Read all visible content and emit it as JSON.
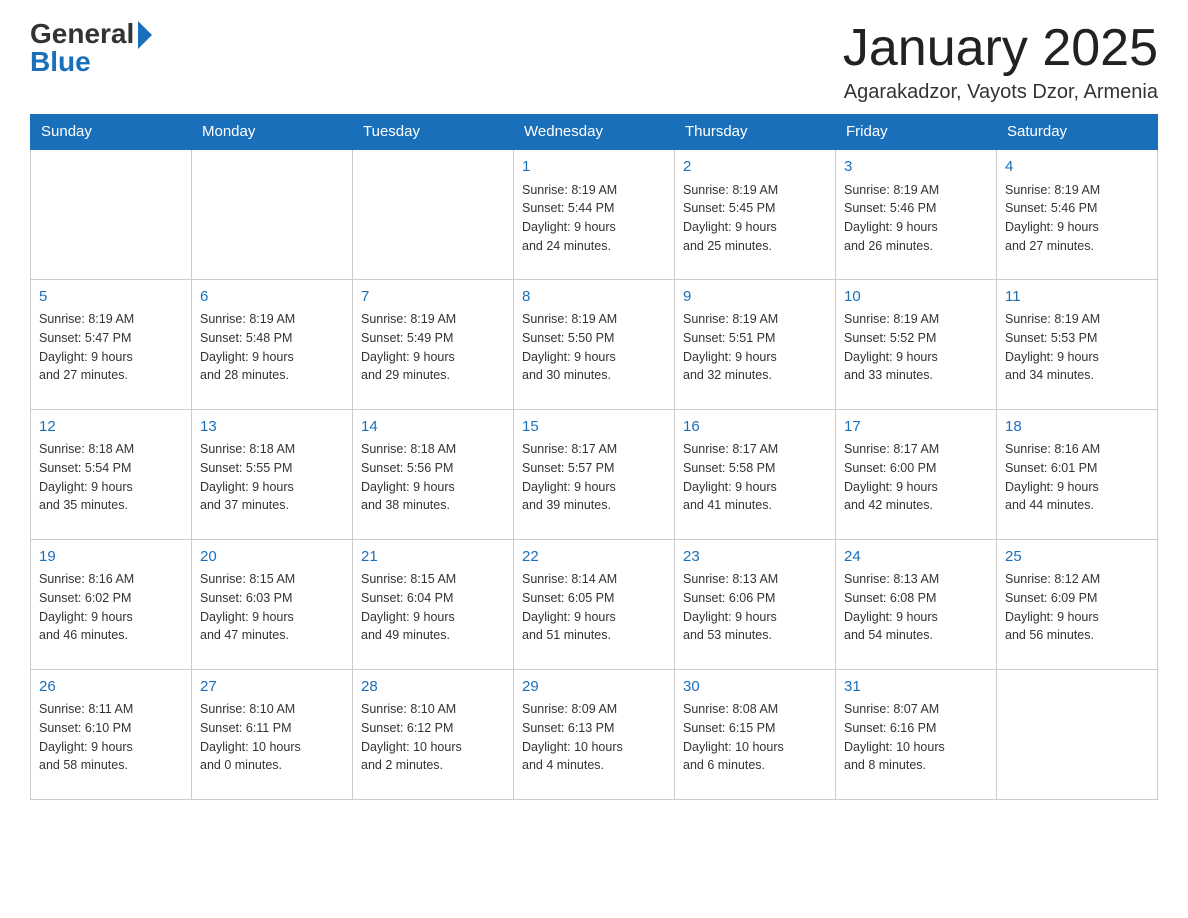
{
  "header": {
    "logo_general": "General",
    "logo_blue": "Blue",
    "title": "January 2025",
    "location": "Agarakadzor, Vayots Dzor, Armenia"
  },
  "days_of_week": [
    "Sunday",
    "Monday",
    "Tuesday",
    "Wednesday",
    "Thursday",
    "Friday",
    "Saturday"
  ],
  "weeks": [
    [
      {
        "day": "",
        "info": ""
      },
      {
        "day": "",
        "info": ""
      },
      {
        "day": "",
        "info": ""
      },
      {
        "day": "1",
        "info": "Sunrise: 8:19 AM\nSunset: 5:44 PM\nDaylight: 9 hours\nand 24 minutes."
      },
      {
        "day": "2",
        "info": "Sunrise: 8:19 AM\nSunset: 5:45 PM\nDaylight: 9 hours\nand 25 minutes."
      },
      {
        "day": "3",
        "info": "Sunrise: 8:19 AM\nSunset: 5:46 PM\nDaylight: 9 hours\nand 26 minutes."
      },
      {
        "day": "4",
        "info": "Sunrise: 8:19 AM\nSunset: 5:46 PM\nDaylight: 9 hours\nand 27 minutes."
      }
    ],
    [
      {
        "day": "5",
        "info": "Sunrise: 8:19 AM\nSunset: 5:47 PM\nDaylight: 9 hours\nand 27 minutes."
      },
      {
        "day": "6",
        "info": "Sunrise: 8:19 AM\nSunset: 5:48 PM\nDaylight: 9 hours\nand 28 minutes."
      },
      {
        "day": "7",
        "info": "Sunrise: 8:19 AM\nSunset: 5:49 PM\nDaylight: 9 hours\nand 29 minutes."
      },
      {
        "day": "8",
        "info": "Sunrise: 8:19 AM\nSunset: 5:50 PM\nDaylight: 9 hours\nand 30 minutes."
      },
      {
        "day": "9",
        "info": "Sunrise: 8:19 AM\nSunset: 5:51 PM\nDaylight: 9 hours\nand 32 minutes."
      },
      {
        "day": "10",
        "info": "Sunrise: 8:19 AM\nSunset: 5:52 PM\nDaylight: 9 hours\nand 33 minutes."
      },
      {
        "day": "11",
        "info": "Sunrise: 8:19 AM\nSunset: 5:53 PM\nDaylight: 9 hours\nand 34 minutes."
      }
    ],
    [
      {
        "day": "12",
        "info": "Sunrise: 8:18 AM\nSunset: 5:54 PM\nDaylight: 9 hours\nand 35 minutes."
      },
      {
        "day": "13",
        "info": "Sunrise: 8:18 AM\nSunset: 5:55 PM\nDaylight: 9 hours\nand 37 minutes."
      },
      {
        "day": "14",
        "info": "Sunrise: 8:18 AM\nSunset: 5:56 PM\nDaylight: 9 hours\nand 38 minutes."
      },
      {
        "day": "15",
        "info": "Sunrise: 8:17 AM\nSunset: 5:57 PM\nDaylight: 9 hours\nand 39 minutes."
      },
      {
        "day": "16",
        "info": "Sunrise: 8:17 AM\nSunset: 5:58 PM\nDaylight: 9 hours\nand 41 minutes."
      },
      {
        "day": "17",
        "info": "Sunrise: 8:17 AM\nSunset: 6:00 PM\nDaylight: 9 hours\nand 42 minutes."
      },
      {
        "day": "18",
        "info": "Sunrise: 8:16 AM\nSunset: 6:01 PM\nDaylight: 9 hours\nand 44 minutes."
      }
    ],
    [
      {
        "day": "19",
        "info": "Sunrise: 8:16 AM\nSunset: 6:02 PM\nDaylight: 9 hours\nand 46 minutes."
      },
      {
        "day": "20",
        "info": "Sunrise: 8:15 AM\nSunset: 6:03 PM\nDaylight: 9 hours\nand 47 minutes."
      },
      {
        "day": "21",
        "info": "Sunrise: 8:15 AM\nSunset: 6:04 PM\nDaylight: 9 hours\nand 49 minutes."
      },
      {
        "day": "22",
        "info": "Sunrise: 8:14 AM\nSunset: 6:05 PM\nDaylight: 9 hours\nand 51 minutes."
      },
      {
        "day": "23",
        "info": "Sunrise: 8:13 AM\nSunset: 6:06 PM\nDaylight: 9 hours\nand 53 minutes."
      },
      {
        "day": "24",
        "info": "Sunrise: 8:13 AM\nSunset: 6:08 PM\nDaylight: 9 hours\nand 54 minutes."
      },
      {
        "day": "25",
        "info": "Sunrise: 8:12 AM\nSunset: 6:09 PM\nDaylight: 9 hours\nand 56 minutes."
      }
    ],
    [
      {
        "day": "26",
        "info": "Sunrise: 8:11 AM\nSunset: 6:10 PM\nDaylight: 9 hours\nand 58 minutes."
      },
      {
        "day": "27",
        "info": "Sunrise: 8:10 AM\nSunset: 6:11 PM\nDaylight: 10 hours\nand 0 minutes."
      },
      {
        "day": "28",
        "info": "Sunrise: 8:10 AM\nSunset: 6:12 PM\nDaylight: 10 hours\nand 2 minutes."
      },
      {
        "day": "29",
        "info": "Sunrise: 8:09 AM\nSunset: 6:13 PM\nDaylight: 10 hours\nand 4 minutes."
      },
      {
        "day": "30",
        "info": "Sunrise: 8:08 AM\nSunset: 6:15 PM\nDaylight: 10 hours\nand 6 minutes."
      },
      {
        "day": "31",
        "info": "Sunrise: 8:07 AM\nSunset: 6:16 PM\nDaylight: 10 hours\nand 8 minutes."
      },
      {
        "day": "",
        "info": ""
      }
    ]
  ]
}
